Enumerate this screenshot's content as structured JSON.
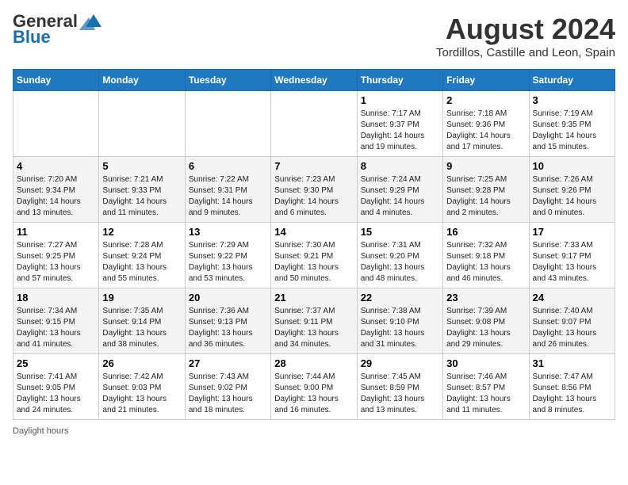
{
  "header": {
    "logo_line1": "General",
    "logo_line2": "Blue",
    "month_title": "August 2024",
    "location": "Tordillos, Castille and Leon, Spain"
  },
  "days_of_week": [
    "Sunday",
    "Monday",
    "Tuesday",
    "Wednesday",
    "Thursday",
    "Friday",
    "Saturday"
  ],
  "weeks": [
    [
      {
        "day": "",
        "info": ""
      },
      {
        "day": "",
        "info": ""
      },
      {
        "day": "",
        "info": ""
      },
      {
        "day": "",
        "info": ""
      },
      {
        "day": "1",
        "info": "Sunrise: 7:17 AM\nSunset: 9:37 PM\nDaylight: 14 hours\nand 19 minutes."
      },
      {
        "day": "2",
        "info": "Sunrise: 7:18 AM\nSunset: 9:36 PM\nDaylight: 14 hours\nand 17 minutes."
      },
      {
        "day": "3",
        "info": "Sunrise: 7:19 AM\nSunset: 9:35 PM\nDaylight: 14 hours\nand 15 minutes."
      }
    ],
    [
      {
        "day": "4",
        "info": "Sunrise: 7:20 AM\nSunset: 9:34 PM\nDaylight: 14 hours\nand 13 minutes."
      },
      {
        "day": "5",
        "info": "Sunrise: 7:21 AM\nSunset: 9:33 PM\nDaylight: 14 hours\nand 11 minutes."
      },
      {
        "day": "6",
        "info": "Sunrise: 7:22 AM\nSunset: 9:31 PM\nDaylight: 14 hours\nand 9 minutes."
      },
      {
        "day": "7",
        "info": "Sunrise: 7:23 AM\nSunset: 9:30 PM\nDaylight: 14 hours\nand 6 minutes."
      },
      {
        "day": "8",
        "info": "Sunrise: 7:24 AM\nSunset: 9:29 PM\nDaylight: 14 hours\nand 4 minutes."
      },
      {
        "day": "9",
        "info": "Sunrise: 7:25 AM\nSunset: 9:28 PM\nDaylight: 14 hours\nand 2 minutes."
      },
      {
        "day": "10",
        "info": "Sunrise: 7:26 AM\nSunset: 9:26 PM\nDaylight: 14 hours\nand 0 minutes."
      }
    ],
    [
      {
        "day": "11",
        "info": "Sunrise: 7:27 AM\nSunset: 9:25 PM\nDaylight: 13 hours\nand 57 minutes."
      },
      {
        "day": "12",
        "info": "Sunrise: 7:28 AM\nSunset: 9:24 PM\nDaylight: 13 hours\nand 55 minutes."
      },
      {
        "day": "13",
        "info": "Sunrise: 7:29 AM\nSunset: 9:22 PM\nDaylight: 13 hours\nand 53 minutes."
      },
      {
        "day": "14",
        "info": "Sunrise: 7:30 AM\nSunset: 9:21 PM\nDaylight: 13 hours\nand 50 minutes."
      },
      {
        "day": "15",
        "info": "Sunrise: 7:31 AM\nSunset: 9:20 PM\nDaylight: 13 hours\nand 48 minutes."
      },
      {
        "day": "16",
        "info": "Sunrise: 7:32 AM\nSunset: 9:18 PM\nDaylight: 13 hours\nand 46 minutes."
      },
      {
        "day": "17",
        "info": "Sunrise: 7:33 AM\nSunset: 9:17 PM\nDaylight: 13 hours\nand 43 minutes."
      }
    ],
    [
      {
        "day": "18",
        "info": "Sunrise: 7:34 AM\nSunset: 9:15 PM\nDaylight: 13 hours\nand 41 minutes."
      },
      {
        "day": "19",
        "info": "Sunrise: 7:35 AM\nSunset: 9:14 PM\nDaylight: 13 hours\nand 38 minutes."
      },
      {
        "day": "20",
        "info": "Sunrise: 7:36 AM\nSunset: 9:13 PM\nDaylight: 13 hours\nand 36 minutes."
      },
      {
        "day": "21",
        "info": "Sunrise: 7:37 AM\nSunset: 9:11 PM\nDaylight: 13 hours\nand 34 minutes."
      },
      {
        "day": "22",
        "info": "Sunrise: 7:38 AM\nSunset: 9:10 PM\nDaylight: 13 hours\nand 31 minutes."
      },
      {
        "day": "23",
        "info": "Sunrise: 7:39 AM\nSunset: 9:08 PM\nDaylight: 13 hours\nand 29 minutes."
      },
      {
        "day": "24",
        "info": "Sunrise: 7:40 AM\nSunset: 9:07 PM\nDaylight: 13 hours\nand 26 minutes."
      }
    ],
    [
      {
        "day": "25",
        "info": "Sunrise: 7:41 AM\nSunset: 9:05 PM\nDaylight: 13 hours\nand 24 minutes."
      },
      {
        "day": "26",
        "info": "Sunrise: 7:42 AM\nSunset: 9:03 PM\nDaylight: 13 hours\nand 21 minutes."
      },
      {
        "day": "27",
        "info": "Sunrise: 7:43 AM\nSunset: 9:02 PM\nDaylight: 13 hours\nand 18 minutes."
      },
      {
        "day": "28",
        "info": "Sunrise: 7:44 AM\nSunset: 9:00 PM\nDaylight: 13 hours\nand 16 minutes."
      },
      {
        "day": "29",
        "info": "Sunrise: 7:45 AM\nSunset: 8:59 PM\nDaylight: 13 hours\nand 13 minutes."
      },
      {
        "day": "30",
        "info": "Sunrise: 7:46 AM\nSunset: 8:57 PM\nDaylight: 13 hours\nand 11 minutes."
      },
      {
        "day": "31",
        "info": "Sunrise: 7:47 AM\nSunset: 8:56 PM\nDaylight: 13 hours\nand 8 minutes."
      }
    ]
  ],
  "footer": {
    "note": "Daylight hours"
  }
}
